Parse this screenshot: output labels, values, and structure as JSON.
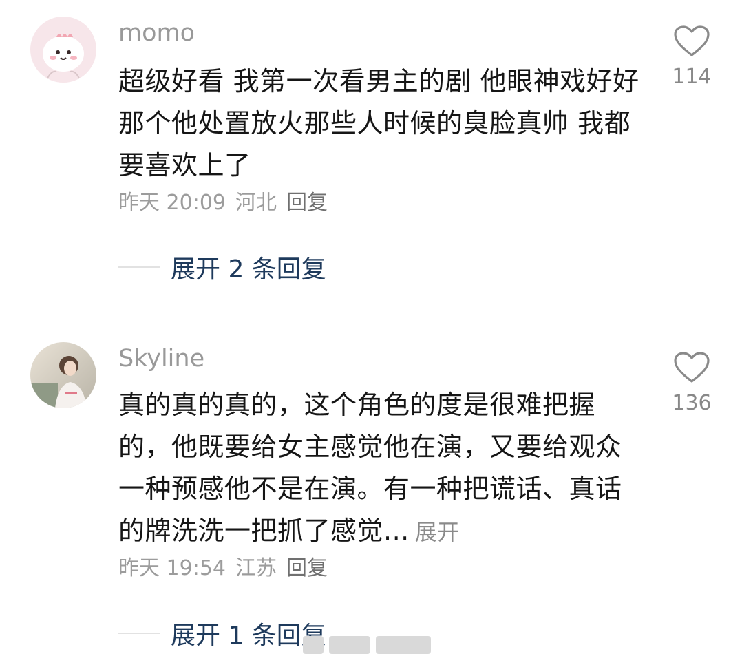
{
  "comments": [
    {
      "username": "momo",
      "content": "超级好看 我第一次看男主的剧 他眼神戏好好 那个他处置放火那些人时候的臭脸真帅 我都要喜欢上了",
      "time": "昨天 20:09",
      "location": "河北",
      "reply_label": "回复",
      "like_count": "114",
      "expand_replies": "展开 2 条回复",
      "avatar": "cartoon-avatar"
    },
    {
      "username": "Skyline",
      "content": "真的真的真的，这个角色的度是很难把握的，他既要给女主感觉他在演，又要给观众一种预感他不是在演。有一种把谎话、真话的牌洗洗一把抓了感觉...",
      "expand_inline": "展开",
      "time": "昨天 19:54",
      "location": "江苏",
      "reply_label": "回复",
      "like_count": "136",
      "expand_replies": "展开 1 条回复",
      "avatar": "photo-avatar"
    }
  ],
  "icons": {
    "like": "heart-outline-icon"
  },
  "colors": {
    "link": "#1e3a5c",
    "muted": "#999999",
    "text": "#161616"
  }
}
